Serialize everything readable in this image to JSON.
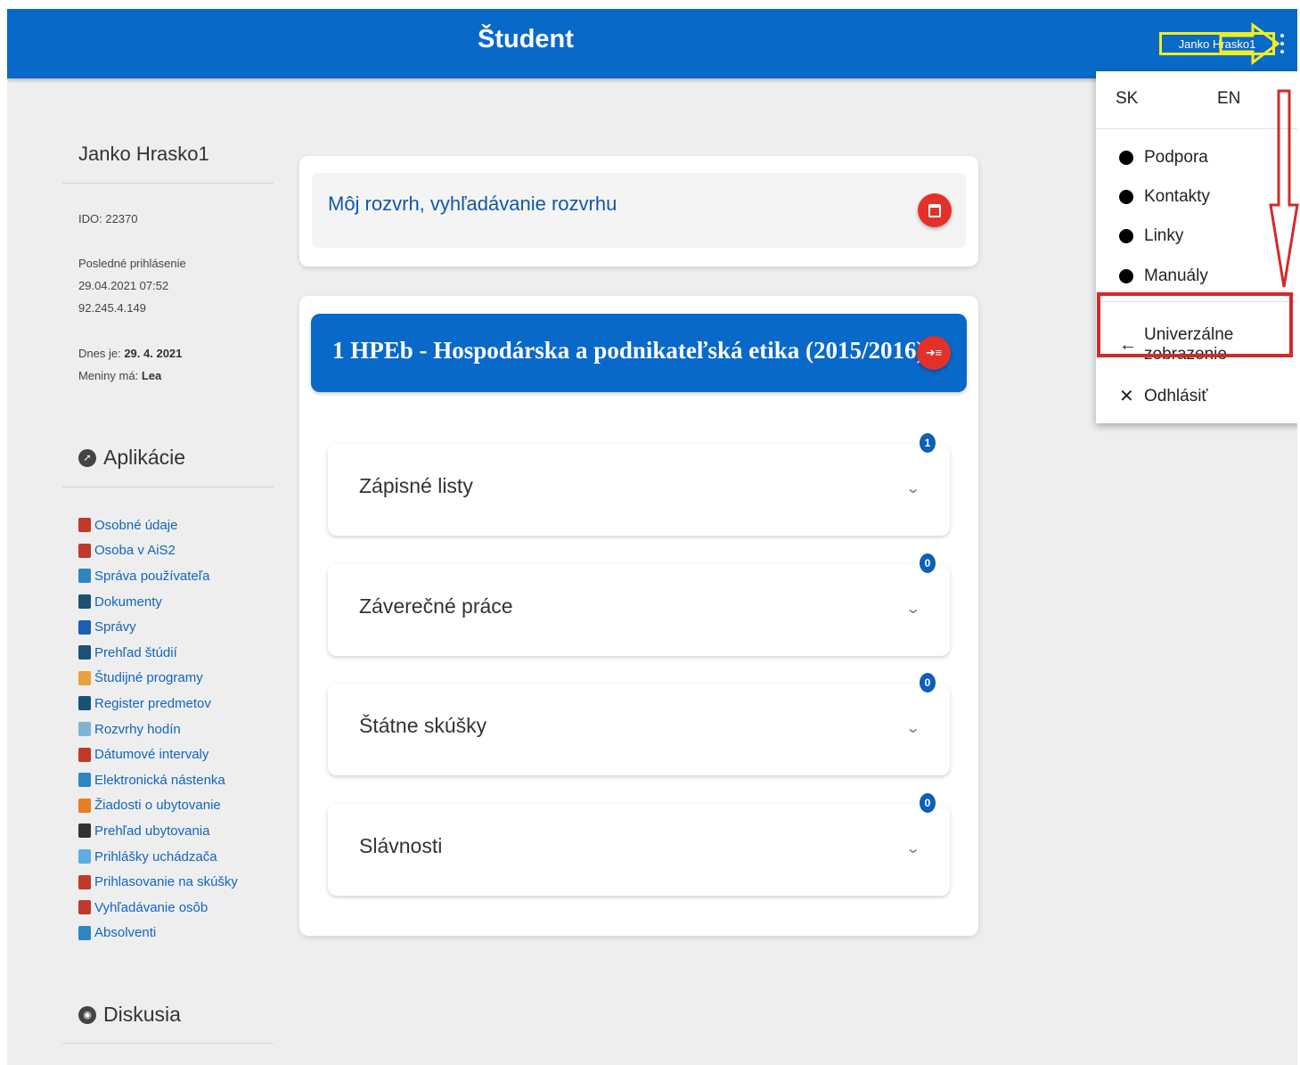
{
  "header": {
    "title": "Študent",
    "user_label": "Janko Hrasko1"
  },
  "sidebar": {
    "user_name": "Janko Hrasko1",
    "ido": "IDO: 22370",
    "last_login_label": "Posledné prihlásenie",
    "last_login_time": "29.04.2021 07:52",
    "last_login_ip": "92.245.4.149",
    "today_label": "Dnes je:",
    "today_value": "29. 4. 2021",
    "nameday_label": "Meniny má:",
    "nameday_value": "Lea",
    "apps_heading": "Aplikácie",
    "apps": [
      {
        "label": "Osobné údaje",
        "icon": "person-icon",
        "color": "#c0392b"
      },
      {
        "label": "Osoba v AiS2",
        "icon": "person-icon",
        "color": "#c0392b"
      },
      {
        "label": "Správa používateľa",
        "icon": "users-tree-icon",
        "color": "#2e86c1"
      },
      {
        "label": "Dokumenty",
        "icon": "document-icon",
        "color": "#1a5276"
      },
      {
        "label": "Správy",
        "icon": "message-icon",
        "color": "#1a5fb4"
      },
      {
        "label": "Prehľad štúdií",
        "icon": "study-overview-icon",
        "color": "#1a5276"
      },
      {
        "label": "Študijné programy",
        "icon": "list-icon",
        "color": "#e6a23c"
      },
      {
        "label": "Register predmetov",
        "icon": "register-icon",
        "color": "#1a5276"
      },
      {
        "label": "Rozvrhy hodín",
        "icon": "timetable-icon",
        "color": "#7fb3d5"
      },
      {
        "label": "Dátumové intervaly",
        "icon": "calendar-icon",
        "color": "#c0392b"
      },
      {
        "label": "Elektronická nástenka",
        "icon": "board-icon",
        "color": "#2e86c1"
      },
      {
        "label": "Žiadosti o ubytovanie",
        "icon": "accommodation-request-icon",
        "color": "#e67e22"
      },
      {
        "label": "Prehľad ubytovania",
        "icon": "grid-icon",
        "color": "#333333"
      },
      {
        "label": "Prihlášky uchádzača",
        "icon": "checkbox-icon",
        "color": "#5dade2"
      },
      {
        "label": "Prihlasovanie na skúšky",
        "icon": "exam-check-icon",
        "color": "#c0392b"
      },
      {
        "label": "Vyhľadávanie osôb",
        "icon": "person-search-icon",
        "color": "#c0392b"
      },
      {
        "label": "Absolventi",
        "icon": "graduates-icon",
        "color": "#2e86c1"
      }
    ],
    "discussion_heading": "Diskusia"
  },
  "main": {
    "schedule_title": "Môj rozvrh, vyhľadávanie rozvrhu",
    "course_title": "1 HPEb - Hospodárska a podnikateľská etika (2015/2016)",
    "sections": [
      {
        "label": "Zápisné listy",
        "count": "1"
      },
      {
        "label": "Záverečné práce",
        "count": "0"
      },
      {
        "label": "Štátne skúšky",
        "count": "0"
      },
      {
        "label": "Slávnosti",
        "count": "0"
      }
    ]
  },
  "menu": {
    "lang_sk": "SK",
    "lang_en": "EN",
    "items": [
      {
        "label": "Podpora"
      },
      {
        "label": "Kontakty"
      },
      {
        "label": "Linky"
      },
      {
        "label": "Manuály"
      }
    ],
    "universal_view": "Univerzálne zobrazenie",
    "logout": "Odhlásiť"
  },
  "colors": {
    "primary": "#0969c8",
    "accent_red": "#e3312a",
    "highlight_yellow": "#f2ee1d",
    "highlight_red": "#d32a2a"
  }
}
